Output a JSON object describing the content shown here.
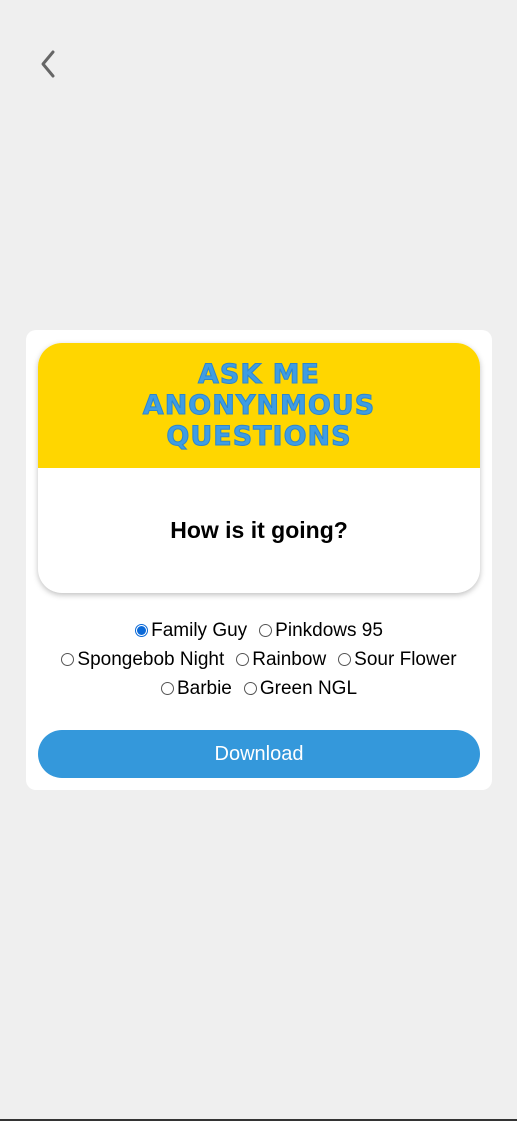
{
  "preview": {
    "title": "Ask me anonynmous questions",
    "question": "How is it going?",
    "colors": {
      "header_bg": "#ffd600",
      "title_color": "#3f9de3"
    }
  },
  "themes": [
    {
      "label": "Family Guy",
      "selected": true
    },
    {
      "label": "Pinkdows 95",
      "selected": false
    },
    {
      "label": "Spongebob Night",
      "selected": false
    },
    {
      "label": "Rainbow",
      "selected": false
    },
    {
      "label": "Sour Flower",
      "selected": false
    },
    {
      "label": "Barbie",
      "selected": false
    },
    {
      "label": "Green NGL",
      "selected": false
    }
  ],
  "actions": {
    "download_label": "Download",
    "back_icon": "chevron-left-icon"
  },
  "colors": {
    "page_bg": "#efefef",
    "accent": "#3498db",
    "radio_selected": "#0a69d8"
  }
}
